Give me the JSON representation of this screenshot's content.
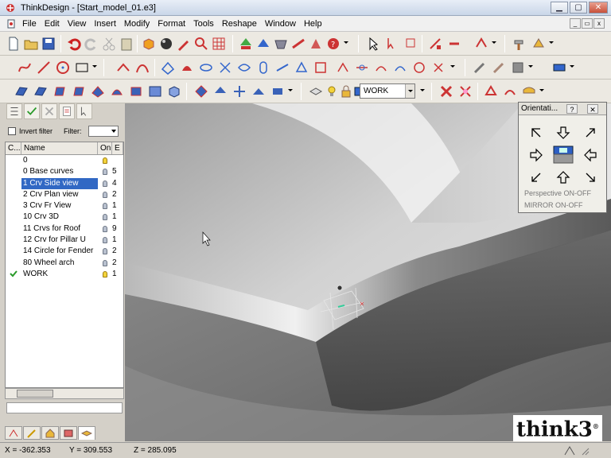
{
  "window": {
    "app_name": "ThinkDesign",
    "title": "ThinkDesign  -  [Start_model_01.e3]",
    "minimize": "▁",
    "restore": "▢",
    "close": "✕"
  },
  "menubar": {
    "items": [
      "File",
      "Edit",
      "View",
      "Insert",
      "Modify",
      "Format",
      "Tools",
      "Reshape",
      "Window",
      "Help"
    ]
  },
  "toolbar": {
    "layer_combo_value": "WORK"
  },
  "layers_panel": {
    "invert_filter_label": "Invert filter",
    "filter_label": "Filter:",
    "filter_value": "",
    "columns": [
      "C...",
      "Name",
      "On",
      "E"
    ],
    "rows": [
      {
        "c": "",
        "name": "0",
        "on": "lit",
        "e": ""
      },
      {
        "c": "",
        "name": "0 Base curves",
        "on": "off",
        "e": "5"
      },
      {
        "c": "",
        "name": "1 Crv Side view",
        "on": "off",
        "e": "4",
        "selected": true
      },
      {
        "c": "",
        "name": "2 Crv Plan view",
        "on": "off",
        "e": "2"
      },
      {
        "c": "",
        "name": "3 Crv Fr View",
        "on": "off",
        "e": "1"
      },
      {
        "c": "",
        "name": "10 Crv 3D",
        "on": "off",
        "e": "1"
      },
      {
        "c": "",
        "name": "11 Crvs for Roof",
        "on": "off",
        "e": "9"
      },
      {
        "c": "",
        "name": "12 Crv for Pillar U",
        "on": "off",
        "e": "1"
      },
      {
        "c": "",
        "name": "14 Circle for Fender",
        "on": "off",
        "e": "2"
      },
      {
        "c": "",
        "name": "80 Wheel arch",
        "on": "off",
        "e": "2"
      },
      {
        "c": "check",
        "name": "WORK",
        "on": "lit",
        "e": "1"
      }
    ]
  },
  "orientation_panel": {
    "title": "Orientati...",
    "help": "?",
    "close": "✕",
    "perspective_label": "Perspective ON-OFF",
    "mirror_label": "MIRROR ON-OFF"
  },
  "status": {
    "x": "X = -362.353",
    "y": "Y = 309.553",
    "z": "Z = 285.095"
  },
  "logo": {
    "text": "think3",
    "mark": "®"
  }
}
